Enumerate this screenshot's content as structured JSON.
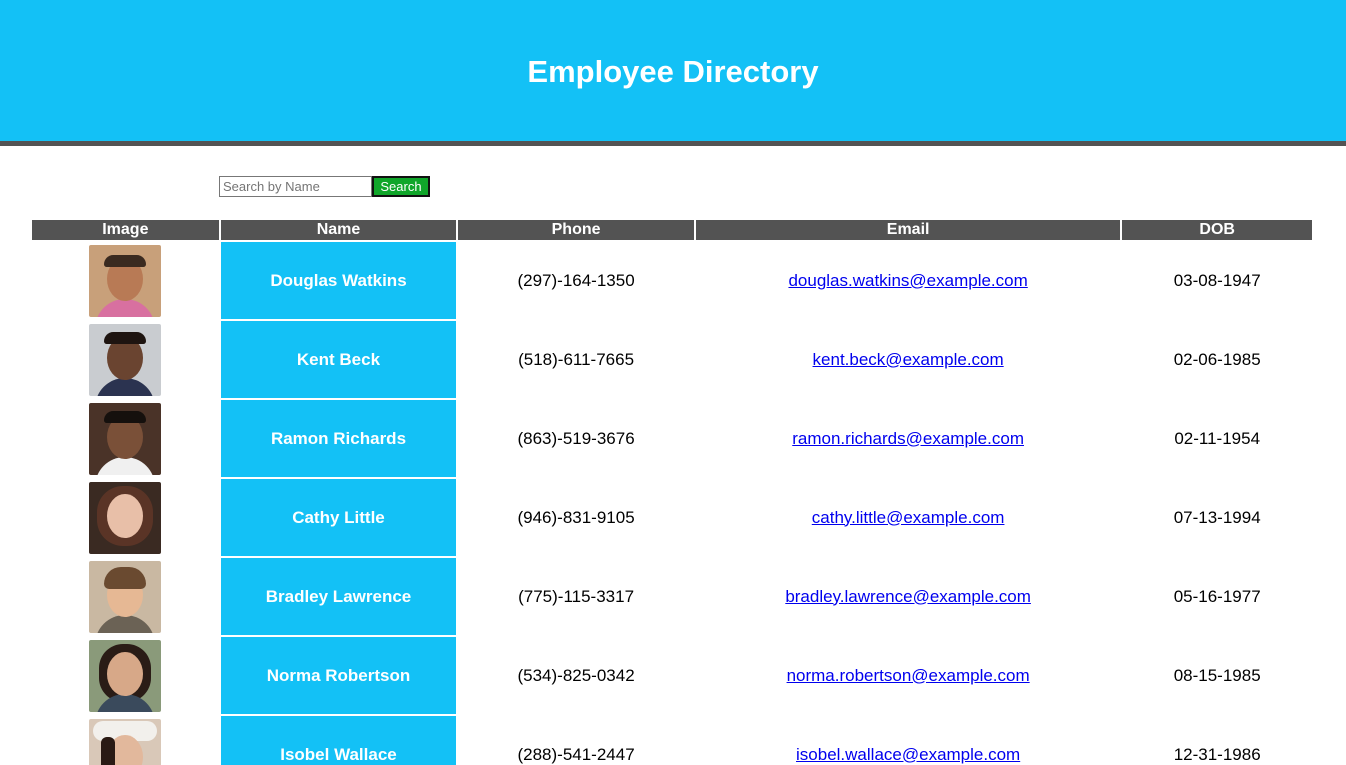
{
  "header": {
    "title": "Employee Directory"
  },
  "search": {
    "placeholder": "Search by Name",
    "value": "",
    "button_label": "Search"
  },
  "table": {
    "columns": [
      "Image",
      "Name",
      "Phone",
      "Email",
      "DOB"
    ],
    "rows": [
      {
        "name": "Douglas Watkins",
        "phone": "(297)-164-1350",
        "email": "douglas.watkins@example.com",
        "dob": "03-08-1947"
      },
      {
        "name": "Kent Beck",
        "phone": "(518)-611-7665",
        "email": "kent.beck@example.com",
        "dob": "02-06-1985"
      },
      {
        "name": "Ramon Richards",
        "phone": "(863)-519-3676",
        "email": "ramon.richards@example.com",
        "dob": "02-11-1954"
      },
      {
        "name": "Cathy Little",
        "phone": "(946)-831-9105",
        "email": "cathy.little@example.com",
        "dob": "07-13-1994"
      },
      {
        "name": "Bradley Lawrence",
        "phone": "(775)-115-3317",
        "email": "bradley.lawrence@example.com",
        "dob": "05-16-1977"
      },
      {
        "name": "Norma Robertson",
        "phone": "(534)-825-0342",
        "email": "norma.robertson@example.com",
        "dob": "08-15-1985"
      },
      {
        "name": "Isobel Wallace",
        "phone": "(288)-541-2447",
        "email": "isobel.wallace@example.com",
        "dob": "12-31-1986"
      }
    ]
  },
  "colors": {
    "header_bg": "#13c1f6",
    "rule": "#535353",
    "table_header_bg": "#535353",
    "name_cell_bg": "#13c1f6",
    "search_button_bg": "#10a62a",
    "link": "#0000ee"
  }
}
